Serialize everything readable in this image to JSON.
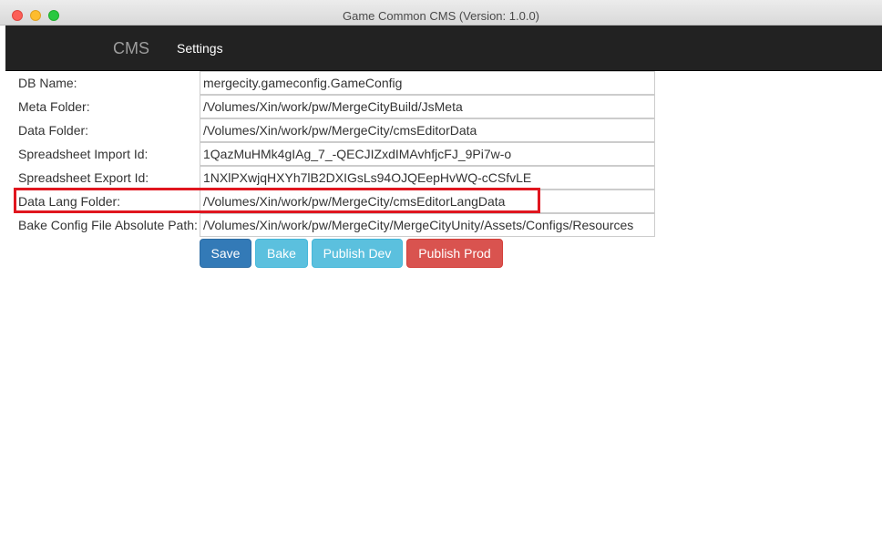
{
  "window": {
    "title": "Game Common CMS (Version: 1.0.0)"
  },
  "navbar": {
    "brand": "CMS",
    "links": [
      "Settings"
    ]
  },
  "settings": [
    {
      "label": "DB Name:",
      "value": "mergecity.gameconfig.GameConfig"
    },
    {
      "label": "Meta Folder:",
      "value": "/Volumes/Xin/work/pw/MergeCityBuild/JsMeta"
    },
    {
      "label": "Data Folder:",
      "value": "/Volumes/Xin/work/pw/MergeCity/cmsEditorData"
    },
    {
      "label": "Spreadsheet Import Id:",
      "value": "1QazMuHMk4gIAg_7_-QECJIZxdIMAvhfjcFJ_9Pi7w-o"
    },
    {
      "label": "Spreadsheet Export Id:",
      "value": "1NXlPXwjqHXYh7lB2DXIGsLs94OJQEepHvWQ-cCSfvLE"
    },
    {
      "label": "Data Lang Folder:",
      "value": "/Volumes/Xin/work/pw/MergeCity/cmsEditorLangData"
    },
    {
      "label": "Bake Config File Absolute Path:",
      "value": "/Volumes/Xin/work/pw/MergeCity/MergeCityUnity/Assets/Configs/Resources"
    }
  ],
  "buttons": {
    "save": "Save",
    "bake": "Bake",
    "publish_dev": "Publish Dev",
    "publish_prod": "Publish Prod"
  },
  "colors": {
    "navbar_bg": "#222222",
    "primary": "#337ab7",
    "info": "#5bc0de",
    "danger": "#d9534f",
    "highlight_border": "#e0161f"
  }
}
